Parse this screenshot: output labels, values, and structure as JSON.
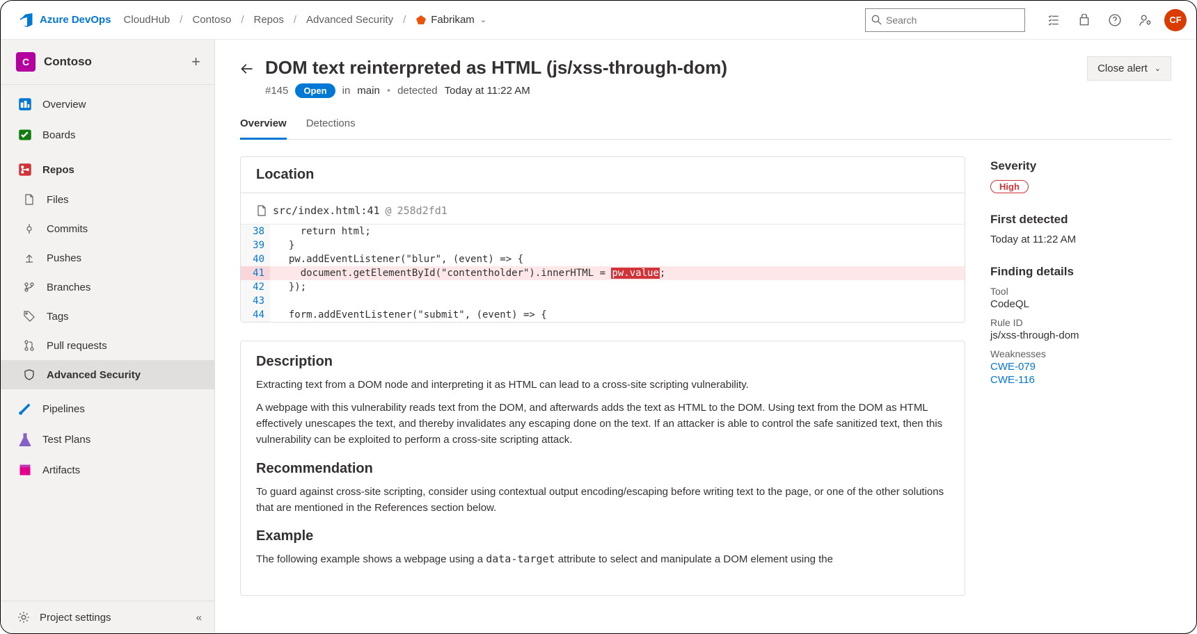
{
  "brand": "Azure DevOps",
  "breadcrumbs": {
    "org": "CloudHub",
    "project": "Contoso",
    "area": "Repos",
    "subarea": "Advanced Security",
    "repo": "Fabrikam"
  },
  "search_placeholder": "Search",
  "avatar_initials": "CF",
  "sidebar": {
    "project_tile": "C",
    "project_name": "Contoso",
    "items": {
      "overview": "Overview",
      "boards": "Boards",
      "repos": "Repos",
      "files": "Files",
      "commits": "Commits",
      "pushes": "Pushes",
      "branches": "Branches",
      "tags": "Tags",
      "pull_requests": "Pull requests",
      "advanced_security": "Advanced Security",
      "pipelines": "Pipelines",
      "test_plans": "Test Plans",
      "artifacts": "Artifacts"
    },
    "footer": "Project settings"
  },
  "alert": {
    "title": "DOM text reinterpreted as HTML (js/xss-through-dom)",
    "number": "#145",
    "status": "Open",
    "in_label": "in",
    "branch": "main",
    "detected_label": "detected",
    "detected_value": "Today at 11:22 AM",
    "close_button": "Close alert"
  },
  "tabs": {
    "overview": "Overview",
    "detections": "Detections"
  },
  "location": {
    "title": "Location",
    "path": "src/index.html:41",
    "at": "@",
    "commit": "258d2fd1",
    "lines": [
      {
        "n": "38",
        "t": "    return html;"
      },
      {
        "n": "39",
        "t": "  }"
      },
      {
        "n": "40",
        "t": "  pw.addEventListener(\"blur\", (event) => {"
      },
      {
        "n": "41",
        "pre": "    document.getElementById(\"contentholder\").innerHTML = ",
        "tok": "pw.value",
        "post": ";"
      },
      {
        "n": "42",
        "t": "  });"
      },
      {
        "n": "43",
        "t": ""
      },
      {
        "n": "44",
        "t": "  form.addEventListener(\"submit\", (event) => {"
      }
    ]
  },
  "desc": {
    "title": "Description",
    "p1": "Extracting text from a DOM node and interpreting it as HTML can lead to a cross-site scripting vulnerability.",
    "p2": "A webpage with this vulnerability reads text from the DOM, and afterwards adds the text as HTML to the DOM. Using text from the DOM as HTML effectively unescapes the text, and thereby invalidates any escaping done on the text. If an attacker is able to control the safe sanitized text, then this vulnerability can be exploited to perform a cross-site scripting attack.",
    "rec_title": "Recommendation",
    "rec_p": "To guard against cross-site scripting, consider using contextual output encoding/escaping before writing text to the page, or one of the other solutions that are mentioned in the References section below.",
    "ex_title": "Example",
    "ex_p_pre": "The following example shows a webpage using a ",
    "ex_code": "data-target",
    "ex_p_post": " attribute to select and manipulate a DOM element using the"
  },
  "right": {
    "severity_label": "Severity",
    "severity_value": "High",
    "first_detected_label": "First detected",
    "first_detected_value": "Today at 11:22 AM",
    "finding_label": "Finding details",
    "tool_label": "Tool",
    "tool_value": "CodeQL",
    "rule_label": "Rule ID",
    "rule_value": "js/xss-through-dom",
    "weak_label": "Weaknesses",
    "cwe1": "CWE-079",
    "cwe2": "CWE-116"
  }
}
